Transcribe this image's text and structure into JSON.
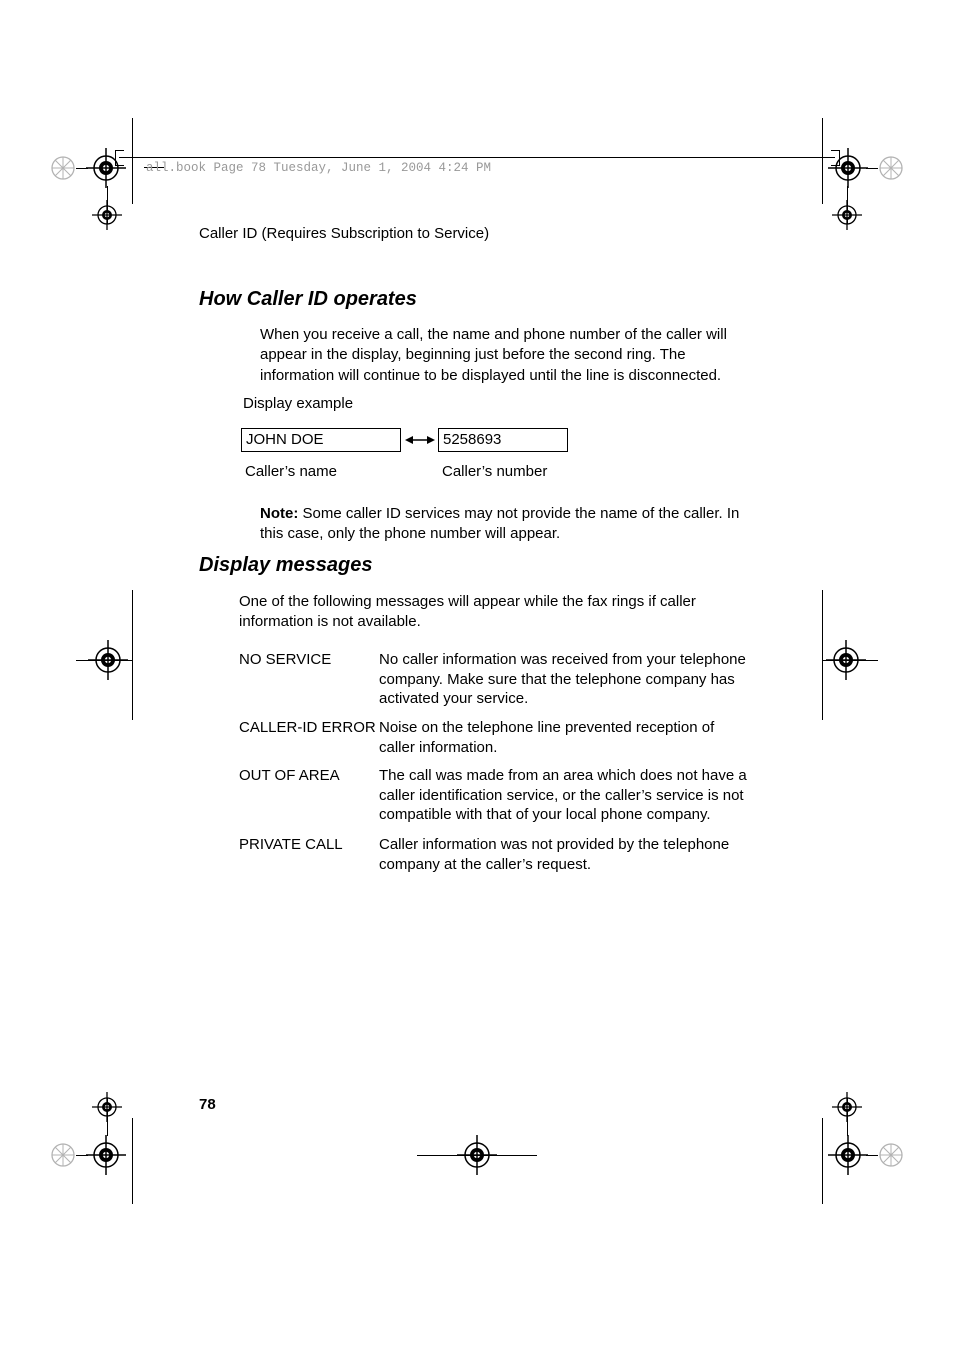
{
  "header_path": "all.book  Page 78  Tuesday, June 1, 2004  4:24 PM",
  "running_header": "Caller ID (Requires Subscription to Service)",
  "sections": {
    "how": {
      "heading": "How Caller ID operates",
      "paragraph": "When you receive a call, the name and phone number of the caller will appear in the display, beginning just before the second ring. The information will continue to be displayed until the line is disconnected.",
      "display_example_label": "Display example",
      "caller_name_value": "JOHN DOE",
      "caller_number_value": "5258693",
      "caller_name_caption": "Caller’s name",
      "caller_number_caption": "Caller’s number",
      "note_bold": "Note:",
      "note_text": " Some caller ID services may not provide the name of the caller. In this case, only the phone number will appear."
    },
    "display_msgs": {
      "heading": "Display messages",
      "intro": "One of the following messages will appear while the fax rings if caller information is not available.",
      "rows": [
        {
          "label": "NO SERVICE",
          "desc": "No caller information was received from your telephone company. Make sure that the telephone company has activated your service."
        },
        {
          "label": "CALLER-ID ERROR",
          "desc": "Noise on the telephone line prevented reception of caller information."
        },
        {
          "label": "OUT OF AREA",
          "desc": "The call was made from an area which does not have a caller identification service, or the caller’s service is not compatible with that of your local phone company."
        },
        {
          "label": "PRIVATE CALL",
          "desc": "Caller information was not provided by the telephone company at the caller’s request."
        }
      ]
    }
  },
  "page_number": "78"
}
